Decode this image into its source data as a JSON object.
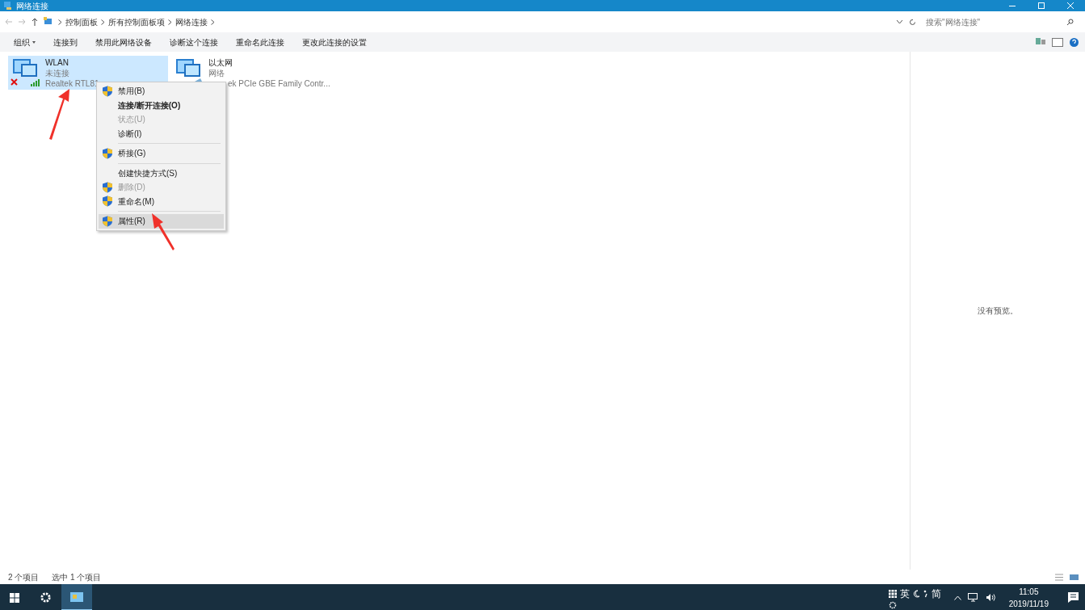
{
  "window": {
    "title": "网络连接"
  },
  "breadcrumb": [
    "控制面板",
    "所有控制面板项",
    "网络连接"
  ],
  "search": {
    "placeholder": "搜索\"网络连接\""
  },
  "toolbar": [
    "组织",
    "连接到",
    "禁用此网络设备",
    "诊断这个连接",
    "重命名此连接",
    "更改此连接的设置"
  ],
  "connections": [
    {
      "kind": "wifi",
      "name": "WLAN",
      "status": "未连接",
      "device": "Realtek RTL81",
      "selected": true,
      "disconnected": true
    },
    {
      "kind": "ethernet",
      "name": "以太网",
      "status": "网络",
      "device": "ek PCIe GBE Family Contr...",
      "selected": false,
      "disconnected": false
    }
  ],
  "context_menu": [
    {
      "kind": "item",
      "label": "禁用(B)",
      "shield": true,
      "disabled": false,
      "bold": false,
      "selected": false
    },
    {
      "kind": "item",
      "label": "连接/断开连接(O)",
      "shield": false,
      "disabled": false,
      "bold": true,
      "selected": false
    },
    {
      "kind": "item",
      "label": "状态(U)",
      "shield": false,
      "disabled": true,
      "bold": false,
      "selected": false
    },
    {
      "kind": "item",
      "label": "诊断(I)",
      "shield": false,
      "disabled": false,
      "bold": false,
      "selected": false
    },
    {
      "kind": "separator"
    },
    {
      "kind": "item",
      "label": "桥接(G)",
      "shield": true,
      "disabled": false,
      "bold": false,
      "selected": false
    },
    {
      "kind": "separator"
    },
    {
      "kind": "item",
      "label": "创建快捷方式(S)",
      "shield": false,
      "disabled": false,
      "bold": false,
      "selected": false
    },
    {
      "kind": "item",
      "label": "删除(D)",
      "shield": true,
      "disabled": true,
      "bold": false,
      "selected": false
    },
    {
      "kind": "item",
      "label": "重命名(M)",
      "shield": true,
      "disabled": false,
      "bold": false,
      "selected": false
    },
    {
      "kind": "separator"
    },
    {
      "kind": "item",
      "label": "属性(R)",
      "shield": true,
      "disabled": false,
      "bold": false,
      "selected": true
    }
  ],
  "preview": {
    "text": "没有预览。"
  },
  "status_bar": {
    "count": "2 个项目",
    "selected": "选中 1 个项目"
  },
  "taskbar": {
    "ime": [
      "英",
      "简"
    ],
    "time": "11:05",
    "date": "2019/11/19"
  }
}
